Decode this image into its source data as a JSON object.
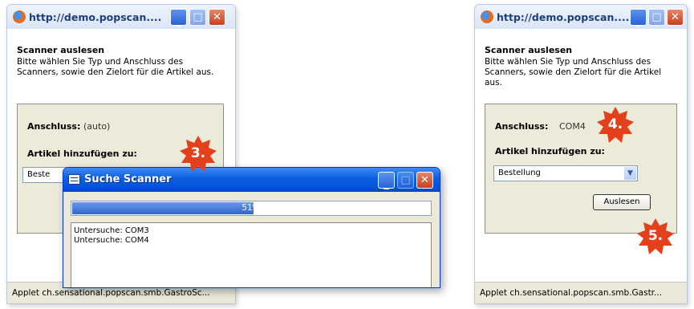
{
  "left_window": {
    "title": "http://demo.popscan....",
    "heading": "Scanner auslesen",
    "description": "Bitte wählen Sie Typ und Anschluss des Scanners, sowie den Zielort für die Artikel aus.",
    "port_label": "Anschluss:",
    "port_value": "(auto)",
    "add_label": "Artikel hinzufügen zu:",
    "select_value": "Beste",
    "status": "Applet ch.sensational.popscan.smb.GastroSc..."
  },
  "dialog": {
    "title": "Suche Scanner",
    "progress_text": "51%",
    "progress_value": 51,
    "log": [
      "Untersuche: COM3",
      "Untersuche: COM4"
    ]
  },
  "right_window": {
    "title": "http://demo.popscan....",
    "heading": "Scanner auslesen",
    "description": "Bitte wählen Sie Typ und Anschluss des Scanners, sowie den Zielort für die Artikel aus.",
    "port_label": "Anschluss:",
    "port_value": "COM4",
    "add_label": "Artikel hinzufügen zu:",
    "select_value": "Bestellung",
    "button_label": "Auslesen",
    "status": "Applet ch.sensational.popscan.smb.Gastr..."
  },
  "badges": {
    "step3": "3.",
    "step4": "4.",
    "step5": "5."
  },
  "colors": {
    "badge": "#e3401b",
    "titlebar_xp": "#0451d6",
    "progress": "#3366cc"
  }
}
